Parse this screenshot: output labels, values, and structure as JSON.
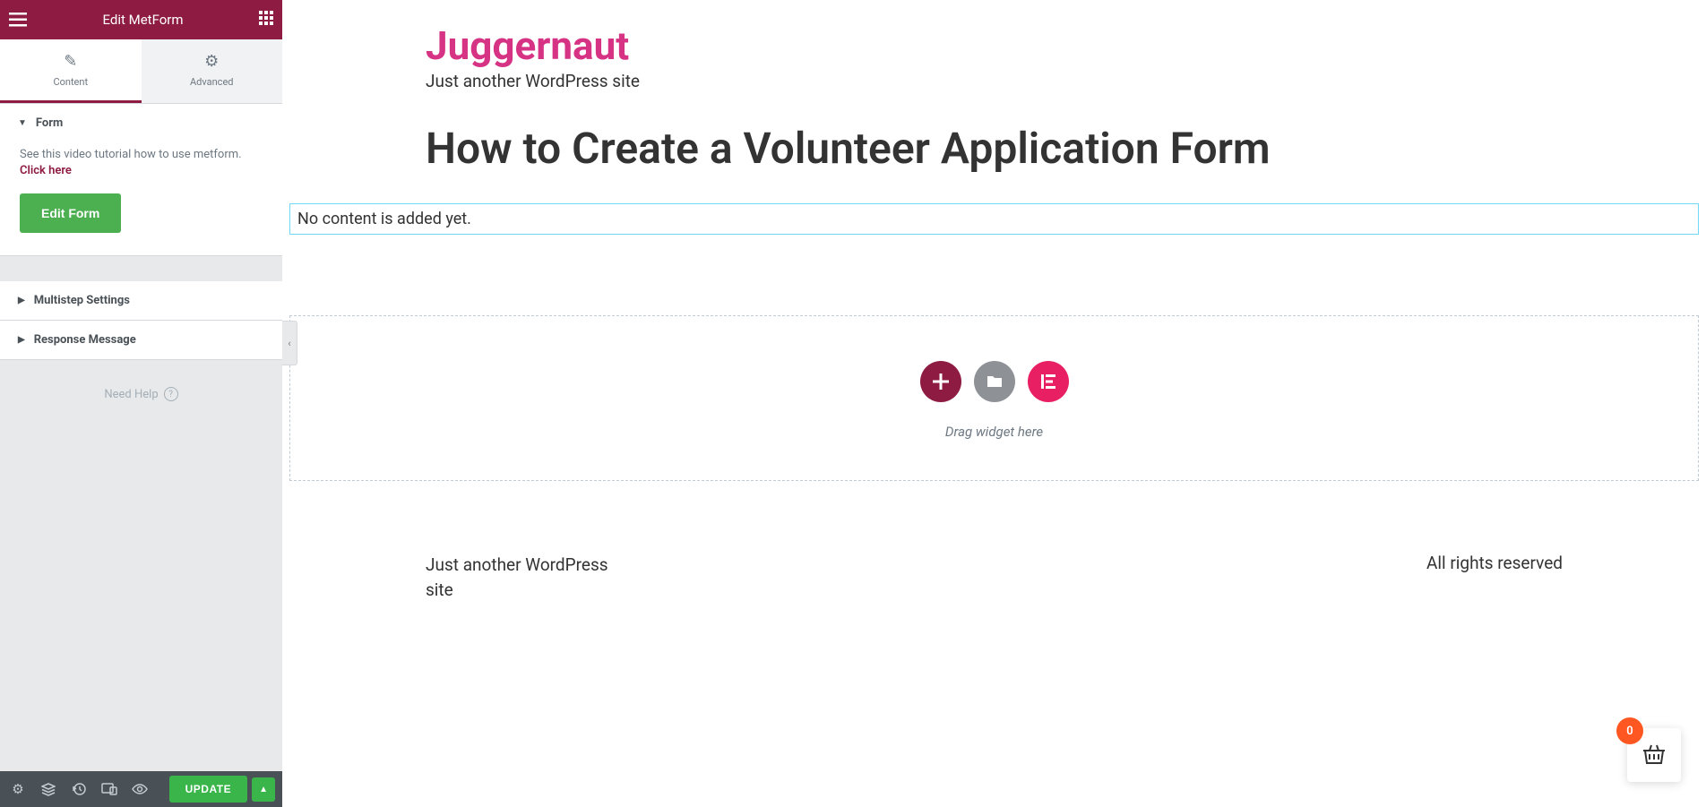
{
  "header": {
    "title": "Edit MetForm"
  },
  "tabs": {
    "content": "Content",
    "advanced": "Advanced"
  },
  "sections": {
    "form": {
      "title": "Form",
      "tutorialText": "See this video tutorial how to use metform. ",
      "tutorialLink": "Click here",
      "editButton": "Edit Form"
    },
    "multistep": {
      "title": "Multistep Settings"
    },
    "response": {
      "title": "Response Message"
    }
  },
  "help": {
    "text": "Need Help"
  },
  "footer": {
    "updateButton": "UPDATE"
  },
  "preview": {
    "siteTitle": "Juggernaut",
    "siteTagline": "Just another WordPress site",
    "pageTitle": "How to Create a Volunteer Application Form",
    "contentPlaceholder": "No content is added yet.",
    "dropText": "Drag widget here",
    "footerLeft": "Just another WordPress site",
    "footerRight": "All rights reserved"
  },
  "cart": {
    "count": "0"
  }
}
